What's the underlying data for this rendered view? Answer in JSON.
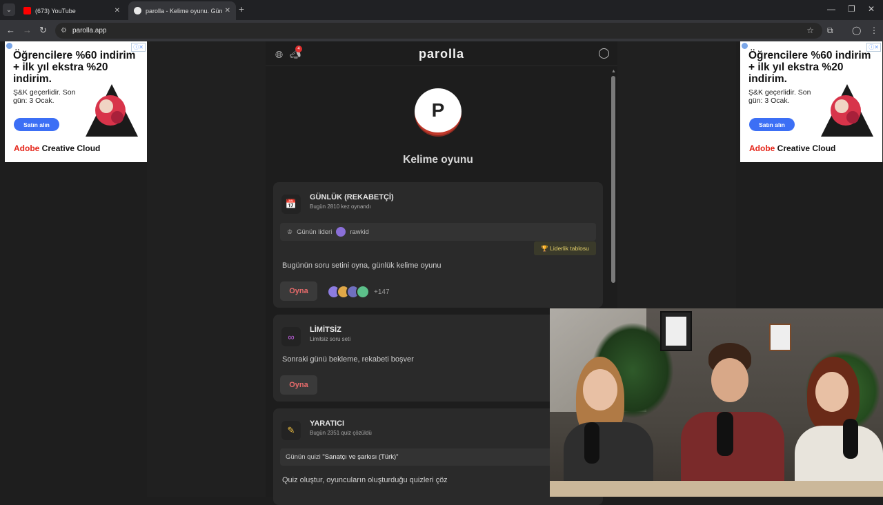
{
  "browser": {
    "tabs": [
      {
        "title": "(673) YouTube",
        "active": false,
        "favicon_color": "#ff0000"
      },
      {
        "title": "parolla - Kelime oyunu. Günlük",
        "active": true,
        "favicon_color": "#e8e8e8"
      }
    ],
    "url": "parolla.app"
  },
  "ad": {
    "headline": "Öğrencilere %60 indirim + ilk yıl ekstra %20 indirim.",
    "sub": "Ş&K geçerlidir. Son gün: 3 Ocak.",
    "cta": "Satın alın",
    "brand_red": "Adobe",
    "brand_rest": " Creative Cloud"
  },
  "app": {
    "logo": "parolla",
    "notification_count": "4",
    "hero_letter": "P",
    "hero_title": "Kelime oyunu",
    "accent": "#e86b6b",
    "cards": {
      "daily": {
        "icon": "calendar-icon",
        "title": "GÜNLÜK (REKABETÇİ)",
        "sub": "Bugün 2810 kez oynandı",
        "leader_label": "Günün lideri",
        "leader_name": "rawkid",
        "leaderboard": "🏆 Liderlik tablosu",
        "desc": "Bugünün soru setini oyna, günlük kelime oyunu",
        "play": "Oyna",
        "more_players": "+147"
      },
      "unlimited": {
        "icon": "infinity-icon",
        "title": "LİMİTSİZ",
        "sub": "Limitsiz soru seti",
        "desc": "Sonraki günü bekleme, rekabeti boşver",
        "play": "Oyna"
      },
      "creator": {
        "icon": "pencil-icon",
        "title": "YARATICI",
        "sub": "Bugün 2351 quiz çözüldü",
        "quiz_label": "Günün quizi",
        "quiz_name": "\"Sanatçı ve şarkısı (Türk)\"",
        "desc": "Quiz oluştur, oyuncuların oluşturduğu quizleri çöz"
      }
    }
  }
}
